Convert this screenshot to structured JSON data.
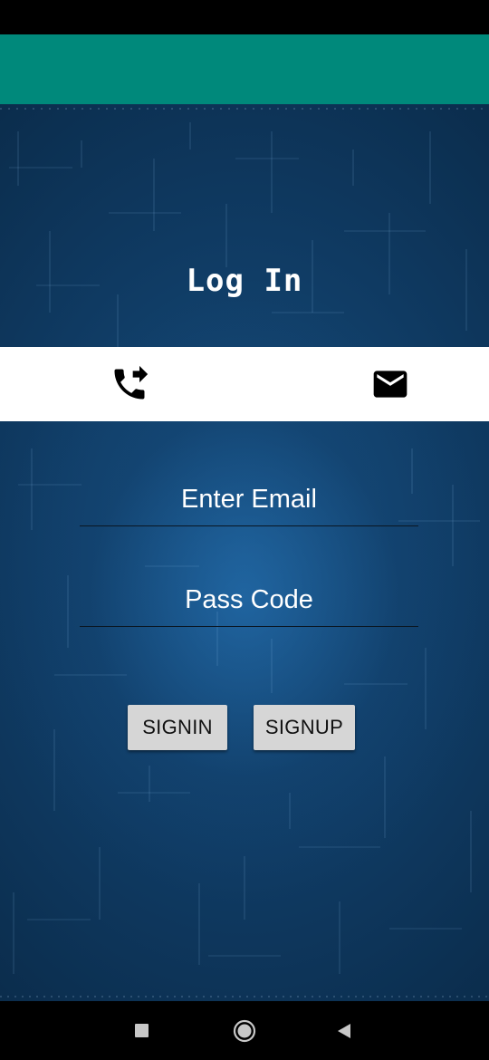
{
  "screen": {
    "title": "Log In"
  },
  "tabs": [
    {
      "icon": "phone-forwarded-icon"
    },
    {
      "icon": "mail-icon"
    }
  ],
  "form": {
    "email_placeholder": "Enter Email",
    "email_value": "",
    "passcode_placeholder": "Pass Code",
    "passcode_value": "",
    "signin_label": "SIGNIN",
    "signup_label": "SIGNUP"
  },
  "colors": {
    "app_bar": "#00897b",
    "background_dark": "#0a2a48",
    "background_light": "#174f7f",
    "button": "#d6d6d6",
    "tab_strip": "#ffffff"
  },
  "navigation": {
    "icons": [
      "recent-apps-icon",
      "home-icon",
      "back-icon"
    ]
  }
}
